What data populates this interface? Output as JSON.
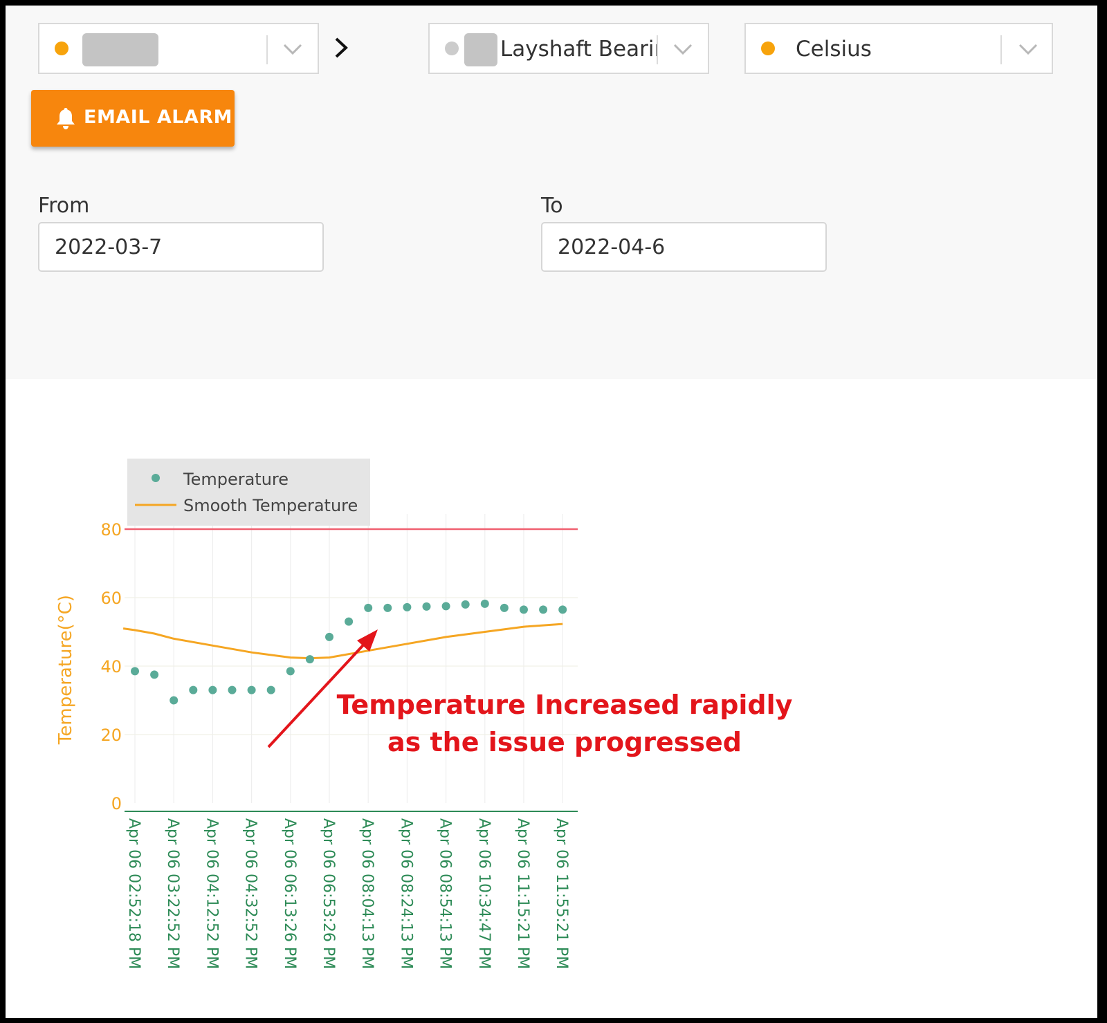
{
  "selectors": {
    "asset": {
      "value": "",
      "dot_color": "#f7a30c"
    },
    "sensor": {
      "value": "Layshaft Bearing",
      "dot_color": "#cccccc"
    },
    "unit": {
      "value": "Celsius",
      "dot_color": "#f7a30c"
    }
  },
  "email_alarm_button": {
    "label": "EMAIL ALARM",
    "icon": "bell-icon"
  },
  "date_range": {
    "from_label": "From",
    "from_value": "2022-03-7",
    "to_label": "To",
    "to_value": "2022-04-6"
  },
  "chart_data": {
    "type": "scatter",
    "ylabel": "Temperature(°C)",
    "ylim": [
      0,
      80
    ],
    "yticks": [
      "0",
      "20",
      "40",
      "60",
      "80"
    ],
    "threshold": 80,
    "categories": [
      "Apr 06 02:52:18 PM",
      "Apr 06 03:22:52 PM",
      "Apr 06 04:12:52 PM",
      "Apr 06 04:32:52 PM",
      "Apr 06 06:13:26 PM",
      "Apr 06 06:53:26 PM",
      "Apr 06 08:04:13 PM",
      "Apr 06 08:24:13 PM",
      "Apr 06 08:54:13 PM",
      "Apr 06 10:34:47 PM",
      "Apr 06 11:15:21 PM",
      "Apr 06 11:55:21 PM"
    ],
    "series": [
      {
        "name": "Temperature",
        "kind": "markers",
        "color": "#5aab98",
        "x": [
          0,
          0.5,
          1,
          1.5,
          2,
          2.5,
          3,
          3.5,
          4,
          4.5,
          5,
          5.5,
          6,
          6.5,
          7,
          7.5,
          8,
          8.5,
          9,
          9.5,
          10,
          10.5,
          11
        ],
        "values": [
          38.5,
          37.5,
          30,
          33,
          33,
          33,
          33,
          33,
          38.5,
          42,
          48.5,
          53,
          57,
          57,
          57.2,
          57.4,
          57.5,
          58,
          58.2,
          57,
          56.5,
          56.5,
          56.5
        ]
      },
      {
        "name": "Smooth Temperature",
        "kind": "line",
        "color": "#f5a623",
        "x": [
          -0.3,
          0,
          0.5,
          1,
          2,
          3,
          4,
          4.5,
          5,
          6,
          7,
          8,
          9,
          10,
          11
        ],
        "values": [
          51,
          50.5,
          49.5,
          48,
          46,
          44,
          42.5,
          42.3,
          42.5,
          44.5,
          46.5,
          48.5,
          50,
          51.5,
          52.3
        ]
      }
    ],
    "legend_position": "top-left",
    "annotation": {
      "text_line1": "Temperature Increased rapidly",
      "text_line2": "as the issue progressed",
      "color": "#e3151b"
    }
  }
}
